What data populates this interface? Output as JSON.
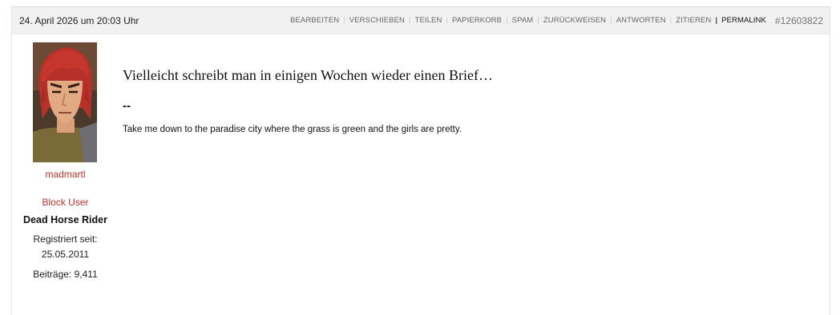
{
  "post": {
    "date": "24. April 2026 um 20:03 Uhr",
    "id": "#12603822",
    "actions": [
      "BEARBEITEN",
      "VERSCHIEBEN",
      "TEILEN",
      "PAPIERKORB",
      "SPAM",
      "ZURÜCKWEISEN",
      "ANTWORTEN",
      "ZITIEREN"
    ],
    "permalink": "PERMALINK",
    "message": "Vielleicht schreibt man in einigen Wochen wieder einen Brief…",
    "signature_separator": "--",
    "signature": "Take me down to the paradise city where the grass is green and the girls are pretty."
  },
  "user": {
    "name": "madmartl",
    "block_label": "Block User",
    "rank": "Dead Horse Rider",
    "registered_label": "Registriert seit:",
    "registered_date": "25.05.2011",
    "posts": "Beiträge: 9,411",
    "avatar_icon": "avatar-red-haired-cartoon-man"
  },
  "colors": {
    "link": "#b3372a",
    "header_bg": "#f1f1f1",
    "action_text": "#666666"
  }
}
